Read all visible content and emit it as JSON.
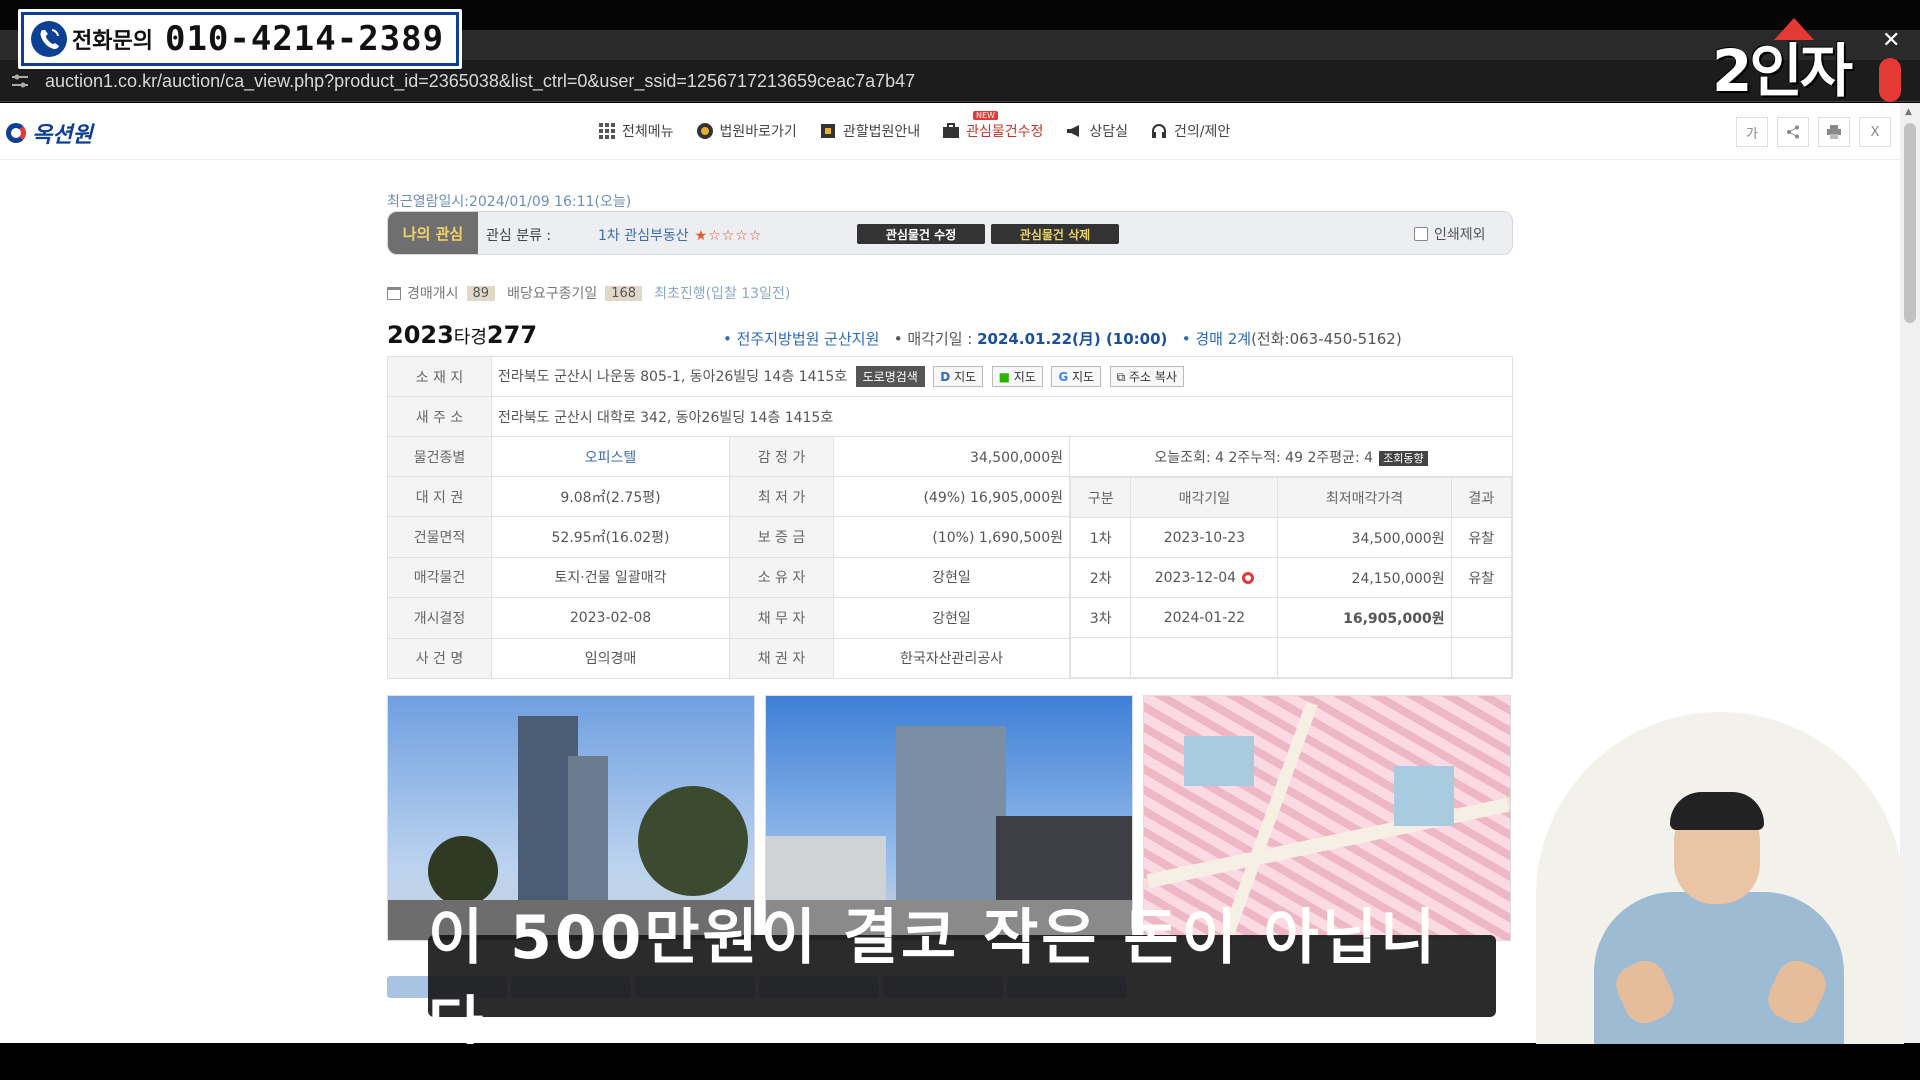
{
  "overlay": {
    "phone_label": "전화문의",
    "phone_number": "010-4214-2389",
    "channel_name": "2인자TV",
    "subtitle": "이 500만원이 결코 작은 돈이 아닙니다"
  },
  "browser": {
    "url": "auction1.co.kr/auction/ca_view.php?product_id=2365038&list_ctrl=0&user_ssid=1256717213659ceac7a7b47"
  },
  "site": {
    "logo": "옥션원",
    "nav": [
      {
        "label": "전체메뉴",
        "icon": "grid-icon"
      },
      {
        "label": "법원바로가기",
        "icon": "court-icon"
      },
      {
        "label": "관할법원안내",
        "icon": "building-icon"
      },
      {
        "label": "관심물건수정",
        "icon": "briefcase-icon",
        "badge": "NEW"
      },
      {
        "label": "상담실",
        "icon": "megaphone-icon"
      },
      {
        "label": "건의/제안",
        "icon": "headset-icon"
      }
    ],
    "tools": [
      "가",
      "share",
      "print",
      "X"
    ]
  },
  "interest": {
    "recent_view": "최근열람일시:2024/01/09 16:11(오늘)",
    "tag": "나의 관심",
    "category_label": "관심 분류 :",
    "category_value": "1차 관심부동산",
    "stars": "★☆☆☆☆",
    "edit_button": "관심물건 수정",
    "delete_button": "관심물건 삭제",
    "print_exclude": "인쇄제외"
  },
  "progress": {
    "start_label": "경매개시",
    "start_days": "89",
    "dividend_label": "배당요구종기일",
    "dividend_days": "168",
    "first_label": "최초진행(입찰 13일전)"
  },
  "case": {
    "year": "2023",
    "type": "타경",
    "number": "277",
    "court": "• 전주지방법원 군산지원",
    "sale_date_label": "• 매각기일 :",
    "sale_date": "2024.01.22(月) (10:00)",
    "dept": "• 경매 2계",
    "phone": "(전화:063-450-5162)"
  },
  "property": {
    "location_label": "소 재 지",
    "location": "전라북도 군산시 나운동 805-1, 동아26빌딩 14층 1415호",
    "addr_buttons": [
      "도로명검색",
      "지도",
      "지도",
      "지도",
      "주소 복사"
    ],
    "new_addr_label": "새 주 소",
    "new_addr": "전라북도 군산시 대학로 342, 동아26빌딩 14층 1415호",
    "rows": [
      {
        "h1": "물건종별",
        "v1": "오피스텔",
        "h2": "감 정 가",
        "v2": "34,500,000원"
      },
      {
        "h1": "대 지 권",
        "v1": "9.08㎡(2.75평)",
        "h2": "최 저 가",
        "v2": "(49%) 16,905,000원"
      },
      {
        "h1": "건물면적",
        "v1": "52.95㎡(16.02평)",
        "h2": "보 증 금",
        "v2": "(10%) 1,690,500원"
      },
      {
        "h1": "매각물건",
        "v1": "토지·건물 일괄매각",
        "h2": "소 유 자",
        "v2": "강현일"
      },
      {
        "h1": "개시결정",
        "v1": "2023-02-08",
        "h2": "채 무 자",
        "v2": "강현일"
      },
      {
        "h1": "사 건 명",
        "v1": "임의경매",
        "h2": "채 권 자",
        "v2": "한국자산관리공사"
      }
    ],
    "views": "오늘조회: 4  2주누적: 49  2주평균: 4",
    "views_button": "조회동향",
    "history_headers": [
      "구분",
      "매각기일",
      "최저매각가격",
      "결과"
    ],
    "history": [
      {
        "round": "1차",
        "date": "2023-10-23",
        "price": "34,500,000원",
        "result": "유찰"
      },
      {
        "round": "2차",
        "date": "2023-12-04",
        "price": "24,150,000원",
        "result": "유찰"
      },
      {
        "round": "3차",
        "date": "2024-01-22",
        "price": "16,905,000원",
        "result": ""
      }
    ]
  }
}
